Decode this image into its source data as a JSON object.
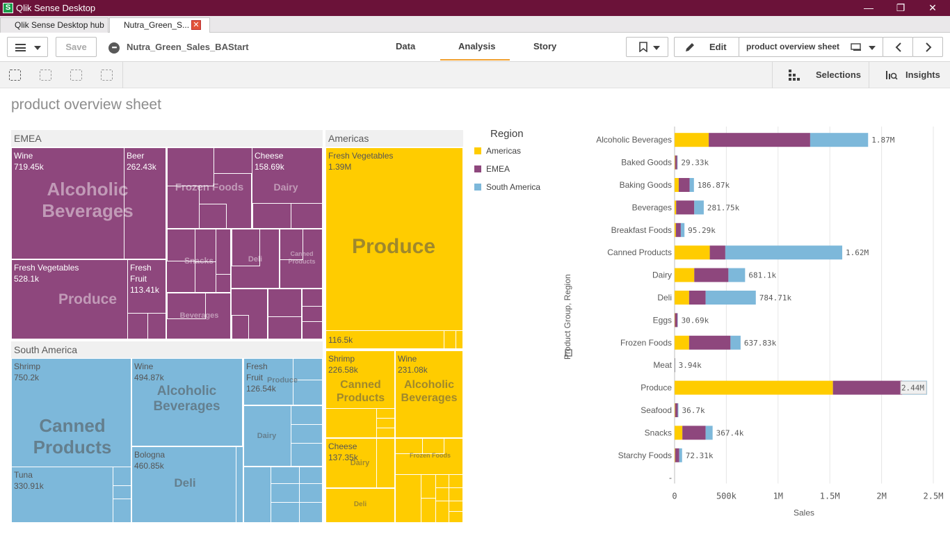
{
  "titlebar": {
    "title": "Qlik Sense Desktop",
    "logo": "S",
    "minimize": "—",
    "restore": "❐",
    "close": "✕"
  },
  "tabs": [
    {
      "label": "Qlik Sense Desktop hub"
    },
    {
      "label": "Nutra_Green_S..."
    }
  ],
  "toolbar": {
    "save_label": "Save",
    "app_name": "Nutra_Green_Sales_BAStart",
    "nav": [
      {
        "label": "Data"
      },
      {
        "label": "Analysis"
      },
      {
        "label": "Story"
      }
    ],
    "edit_label": "Edit",
    "sheet_name": "product overview sheet"
  },
  "subbar": {
    "selections_label": "Selections",
    "insights_label": "Insights"
  },
  "sheet": {
    "title": "product overview sheet"
  },
  "colors": {
    "Americas": "#ffcc00",
    "EMEA": "#8e477d",
    "South America": "#7db8da",
    "accent": "#f0a030",
    "titlebar": "#6b1239"
  },
  "treemap": {
    "regions": [
      {
        "name": "EMEA"
      },
      {
        "name": "South America"
      },
      {
        "name": "Americas"
      }
    ],
    "labels": {
      "emea_wine": [
        "Wine",
        "719.45k"
      ],
      "emea_beer": [
        "Beer",
        "262.43k"
      ],
      "emea_cheese": [
        "Cheese",
        "158.69k"
      ],
      "emea_freshveg": [
        "Fresh Vegetables",
        "528.1k"
      ],
      "emea_freshfruit": [
        "Fresh",
        "Fruit",
        "113.41k"
      ],
      "sa_shrimp": [
        "Shrimp",
        "750.2k"
      ],
      "sa_tuna": [
        "Tuna",
        "330.91k"
      ],
      "sa_wine": [
        "Wine",
        "494.87k"
      ],
      "sa_bologna": [
        "Bologna",
        "460.85k"
      ],
      "sa_freshfruit": [
        "Fresh",
        "Fruit",
        "126.54k"
      ],
      "am_freshveg": [
        "Fresh Vegetables",
        "1.39M"
      ],
      "am_small": [
        "116.5k"
      ],
      "am_shrimp": [
        "Shrimp",
        "226.58k"
      ],
      "am_wine": [
        "Wine",
        "231.08k"
      ],
      "am_cheese": [
        "Cheese",
        "137.35k"
      ]
    },
    "groups": {
      "alcoholic_beverages": [
        "Alcoholic",
        "Beverages"
      ],
      "frozen_foods": "Frozen Foods",
      "dairy": "Dairy",
      "produce": "Produce",
      "snacks": "Snacks",
      "deli": "Deli",
      "canned_products": [
        "Canned",
        "Products"
      ],
      "beverages": "Beverages"
    }
  },
  "legend": {
    "title": "Region",
    "items": [
      {
        "name": "Americas",
        "color": "#ffcc00"
      },
      {
        "name": "EMEA",
        "color": "#8e477d"
      },
      {
        "name": "South America",
        "color": "#7db8da"
      }
    ]
  },
  "chart_data": {
    "type": "bar",
    "orientation": "horizontal",
    "stacked": true,
    "xlabel": "Sales",
    "ylabel": "Product Group, Region",
    "xlim": [
      0,
      2500000
    ],
    "xticks": [
      0,
      500000,
      1000000,
      1500000,
      2000000,
      2500000
    ],
    "xtick_labels": [
      "0",
      "500k",
      "1M",
      "1.5M",
      "2M",
      "2.5M"
    ],
    "grid": true,
    "categories": [
      "Alcoholic Beverages",
      "Baked Goods",
      "Baking Goods",
      "Beverages",
      "Breakfast Foods",
      "Canned Products",
      "Dairy",
      "Deli",
      "Eggs",
      "Frozen Foods",
      "Meat",
      "Produce",
      "Seafood",
      "Snacks",
      "Starchy Foods",
      "-"
    ],
    "series": [
      {
        "name": "Americas",
        "color": "#ffcc00",
        "values": [
          330000,
          5000,
          40000,
          15000,
          12000,
          340000,
          190000,
          140000,
          3000,
          140000,
          1000,
          1530000,
          5000,
          75000,
          5000,
          0
        ]
      },
      {
        "name": "EMEA",
        "color": "#8e477d",
        "values": [
          980000,
          20000,
          105000,
          175000,
          48000,
          150000,
          330000,
          160000,
          25000,
          400000,
          2000,
          670000,
          25000,
          225000,
          40000,
          0
        ]
      },
      {
        "name": "South America",
        "color": "#7db8da",
        "values": [
          560000,
          4330,
          41870,
          91750,
          35290,
          1130000,
          161100,
          484710,
          2690,
          97830,
          940,
          240000,
          6700,
          67400,
          27310,
          0
        ]
      }
    ],
    "total_labels": [
      "1.87M",
      "29.33k",
      "186.87k",
      "281.75k",
      "95.29k",
      "1.62M",
      "681.1k",
      "784.71k",
      "30.69k",
      "637.83k",
      "3.94k",
      "2.44M",
      "36.7k",
      "367.4k",
      "72.31k",
      ""
    ]
  }
}
